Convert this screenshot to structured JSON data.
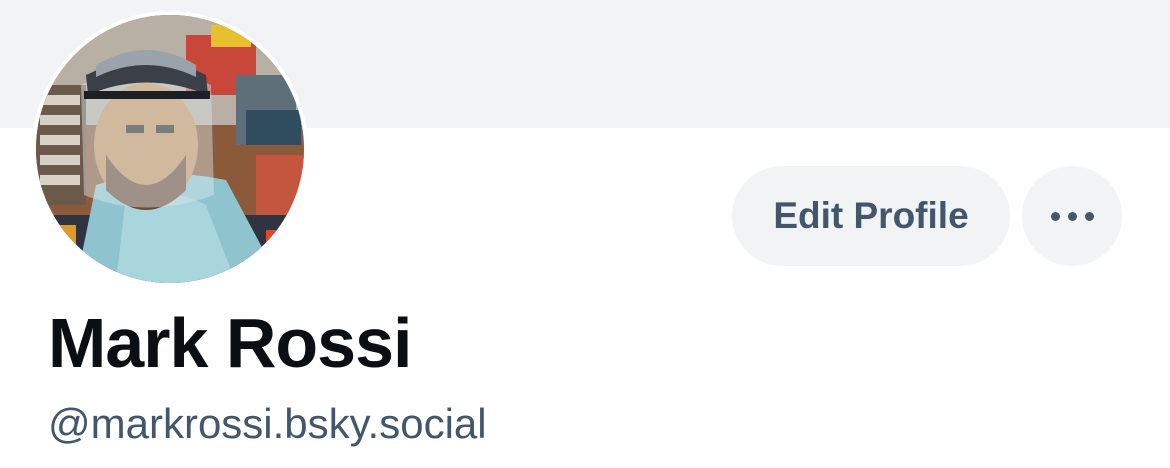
{
  "profile": {
    "display_name": "Mark Rossi",
    "handle": "@markrossi.bsky.social",
    "avatar_alt": "avatar-photo"
  },
  "actions": {
    "edit_label": "Edit Profile",
    "more_icon": "ellipsis-icon"
  },
  "colors": {
    "banner": "#f1f3f5",
    "button_bg": "#f1f3f5",
    "button_text": "#42576c",
    "name_text": "#0b0f14",
    "handle_text": "#42576c"
  }
}
